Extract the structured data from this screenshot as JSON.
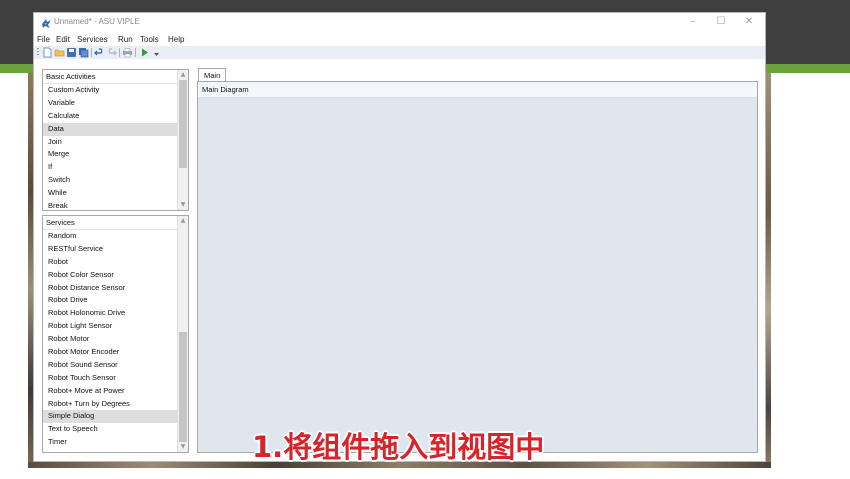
{
  "window": {
    "title": "Unnamed* - ASU VIPLE",
    "controls": {
      "minimize": "–",
      "maximize": "☐",
      "close": "✕"
    }
  },
  "menu": [
    "File",
    "Edit",
    "Services",
    "Run",
    "Tools",
    "Help"
  ],
  "toolbar": {
    "buttons": [
      "new-file-icon",
      "open-folder-icon",
      "save-icon",
      "save-all-icon",
      "undo-icon",
      "redo-icon",
      "print-icon",
      "run-icon",
      "dropdown-icon"
    ]
  },
  "basic_activities": {
    "header": "Basic Activities",
    "items": [
      "Custom Activity",
      "Variable",
      "Calculate",
      "Data",
      "Join",
      "Merge",
      "If",
      "Switch",
      "While",
      "Break"
    ],
    "selected": "Data"
  },
  "services": {
    "header": "Services",
    "items": [
      "Random",
      "RESTful Service",
      "Robot",
      "Robot Color Sensor",
      "Robot Distance Sensor",
      "Robot Drive",
      "Robot Holonomic Drive",
      "Robot Light Sensor",
      "Robot Motor",
      "Robot Motor Encoder",
      "Robot Sound Sensor",
      "Robot Touch Sensor",
      "Robot+ Move at Power",
      "Robot+ Turn by Degrees",
      "Simple Dialog",
      "Text to Speech",
      "Timer"
    ],
    "selected": "Simple Dialog"
  },
  "main": {
    "tab": "Main",
    "diagram_title": "Main Diagram"
  },
  "caption": "1.将组件拖入到视图中",
  "colors": {
    "header_band": "#3f3f3f",
    "accent_green": "#6aa33b",
    "canvas": "#dfe6ee",
    "caption": "#d8232a"
  }
}
